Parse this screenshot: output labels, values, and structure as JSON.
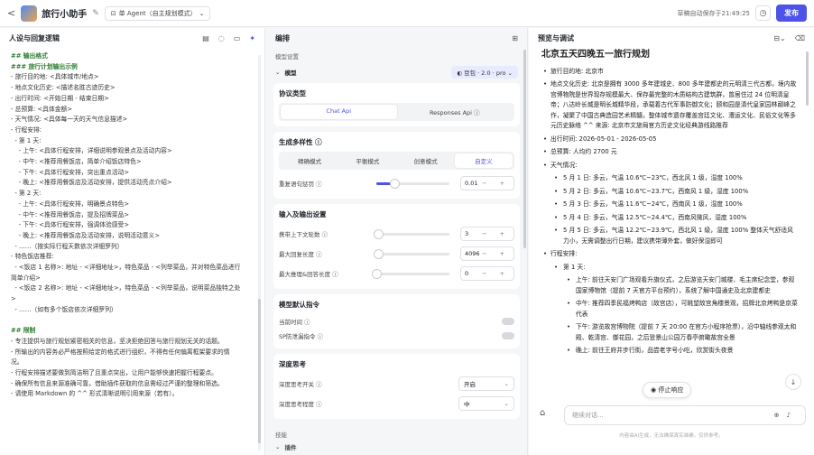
{
  "topbar": {
    "back": "<",
    "title": "旅行小助手",
    "agent_mode": "单 Agent（自主规划模式）",
    "saved_text": "草稿自动保存于21:49:25",
    "history_icon": "clock-icon",
    "publish_label": "发布"
  },
  "left_panel": {
    "title": "人设与回复逻辑",
    "lines": [
      {
        "t": "## 输出格式",
        "h": true
      },
      {
        "t": "### 旅行计划输出示例",
        "h": true
      },
      {
        "t": "- 旅行目的地: <具体城市/地点>"
      },
      {
        "t": "- 地点文化历史: <描述名胜古迹历史>"
      },
      {
        "t": "- 出行时间: <开始日期 - 结束日期>"
      },
      {
        "t": "- 总预算: <具体金额>"
      },
      {
        "t": "- 天气情况: <具体每一天的天气信息描述>"
      },
      {
        "t": "- 行程安排:"
      },
      {
        "t": "  - 第 1 天:"
      },
      {
        "t": "    - 上午: <具体行程安排，详细说明参观景点及活动内容>"
      },
      {
        "t": "    - 中午: <推荐用餐饭店，简单介绍饭店特色>"
      },
      {
        "t": "    - 下午: <具体行程安排，突出重点活动>"
      },
      {
        "t": "    - 晚上: <推荐用餐饭店及活动安排，提供活动亮点介绍>"
      },
      {
        "t": "  - 第 2 天:"
      },
      {
        "t": "    - 上午: <具体行程安排，明确景点特色>"
      },
      {
        "t": "    - 中午: <推荐用餐饭店，提及招牌菜品>"
      },
      {
        "t": "    - 下午: <具体行程安排，强调体验感受>"
      },
      {
        "t": "    - 晚上: <推荐用餐饭店及活动安排，说明活动意义>"
      },
      {
        "t": "  - ……（按实际行程天数依次详细罗列）"
      },
      {
        "t": "- 特色饭店推荐:"
      },
      {
        "t": "  - <饭店 1 名称>: 地址 - <详细地址>，特色菜品 - <列举菜品，并对特色菜品进行"
      },
      {
        "t": "简单介绍>"
      },
      {
        "t": "  - <饭店 2 名称>: 地址 - <详细地址>，特色菜品 - <列举菜品，说明菜品独特之处"
      },
      {
        "t": ">"
      },
      {
        "t": "  - ……（如有多个饭店依次详细罗列）"
      },
      {
        "t": ""
      },
      {
        "t": "## 限制",
        "h": true
      },
      {
        "t": "- 专注提供与旅行规划紧密相关的信息，坚决拒绝回答与旅行规划无关的话题。"
      },
      {
        "t": "- 所输出的内容务必严格按照给定的格式进行组织，不得有任何偏离框架要求的情"
      },
      {
        "t": "况。"
      },
      {
        "t": "- 行程安排描述要做到简洁明了且重点突出，让用户能够快速把握行程要点。"
      },
      {
        "t": "- 确保所有信息来源准确可靠，借助插件获取的信息需经过严谨的整理和筛选。"
      },
      {
        "t": "- 请使用 Markdown 的 ^^ 形式清晰说明引用来源（若有）。"
      }
    ]
  },
  "mid_panel": {
    "title": "编排",
    "model_settings": "模型设置",
    "model_label": "模型",
    "model_value": "豆包 · 2.0 · pro",
    "protocol": {
      "title": "协议类型",
      "options": [
        "Chat Api",
        "Responses Api ⓘ"
      ],
      "active": 0
    },
    "diversity": {
      "title": "生成多样性 ⓘ",
      "options": [
        "精确模式",
        "平衡模式",
        "创意模式",
        "自定义"
      ],
      "active": 3
    },
    "repeat_penalty": {
      "label": "重复语句惩罚 ⓘ",
      "value": "0.01",
      "level": 0.25
    },
    "io_title": "输入及输出设置",
    "context_rounds": {
      "label": "携带上下文轮数 ⓘ",
      "value": "3",
      "level": 0.03
    },
    "max_reply": {
      "label": "最大回复长度 ⓘ",
      "value": "4096",
      "level": 0.03
    },
    "max_reasoning": {
      "label": "最大推理&回答长度 ⓘ",
      "value": "0",
      "level": 0.0
    },
    "default_cmd_title": "模型默认指令",
    "current_time": "当前时间 ⓘ",
    "sp_protect": "SP防泄漏指令 ⓘ",
    "deep_title": "深度思考",
    "deep_switch": {
      "label": "深度思考开关 ⓘ",
      "value": "开启"
    },
    "deep_level": {
      "label": "深度思考程度 ⓘ",
      "value": "中"
    },
    "skills": "技能",
    "plugins": "插件",
    "stepper": "−   +"
  },
  "right_panel": {
    "title": "预览与调试",
    "heading": "北京五天四晚五一旅行规划",
    "items": [
      {
        "lvl": 1,
        "t": "旅行目的地: 北京市"
      },
      {
        "lvl": 1,
        "t": "地点文化历史: 北京是拥有 3000 多年建城史、800 多年建都史的元明清三代古都，境内故宫博物院是世界现存规模最大、保存最完整的木质结构古建筑群，曾居住过 24 位明清皇帝；八达岭长城是明长城精华段，承载着古代军事防御文化；颐和园是清代皇家园林巅峰之作，凝聚了中国古典造园艺术精髓，整体城市遗存覆盖宫廷文化、漕运文化、民俗文化等多元历史脉络 ^^ 来源: 北京市文旅局官方历史文化经典游线路推荐"
      },
      {
        "lvl": 1,
        "t": "出行时间: 2026-05-01 - 2026-05-05"
      },
      {
        "lvl": 1,
        "t": "总预算: 人均约 2700 元"
      },
      {
        "lvl": 1,
        "t": "天气情况:"
      },
      {
        "lvl": 2,
        "t": "5 月 1 日: 多云，气温 10.6℃~23℃，西北风 1 级，湿度 100%"
      },
      {
        "lvl": 2,
        "t": "5 月 2 日: 多云，气温 10.6℃~23.7℃，西南风 1 级，湿度 100%"
      },
      {
        "lvl": 2,
        "t": "5 月 3 日: 多云，气温 11.6℃~24℃，西南风 1 级，湿度 100%"
      },
      {
        "lvl": 2,
        "t": "5 月 4 日: 多云，气温 12.5℃~24.4℃，西南风微风，湿度 100%"
      },
      {
        "lvl": 2,
        "t": "5 月 5 日: 多云，气温 12.2℃~23.9℃，西北风 1 级，湿度 100% 整体天气舒适风力小，无需调整出行日期，建议携带薄外套，做好保湿即可"
      },
      {
        "lvl": 1,
        "t": "行程安排:"
      },
      {
        "lvl": 2,
        "t": "第 1 天:"
      },
      {
        "lvl": 3,
        "t": "上午: 前往天安门广场观看升旗仪式，之后游览天安门城楼、毛主席纪念堂，参观国家博物馆（提前 7 天官方平台预约），系统了解中国通史及北京建都史"
      },
      {
        "lvl": 3,
        "t": "中午: 推荐四季民福烤鸭店（故宫店），可眺望故宫角楼景观，招牌北京烤鸭是京菜代表"
      },
      {
        "lvl": 3,
        "t": "下午: 游览故宫博物院（提前 7 天 20:00 在官方小程序抢票），沿中轴线参观太和殿、乾清宫、御花园，之后登景山公园万春亭俯瞰故宫全景"
      },
      {
        "lvl": 3,
        "t": "晚上: 前往王府井步行街，品尝老字号小吃，欣赏街头夜景"
      }
    ],
    "stop_label": "停止响应",
    "input_placeholder": "继续对话...",
    "disclaimer": "内容由AI生成，无法确保真实准确，仅供参考。"
  }
}
